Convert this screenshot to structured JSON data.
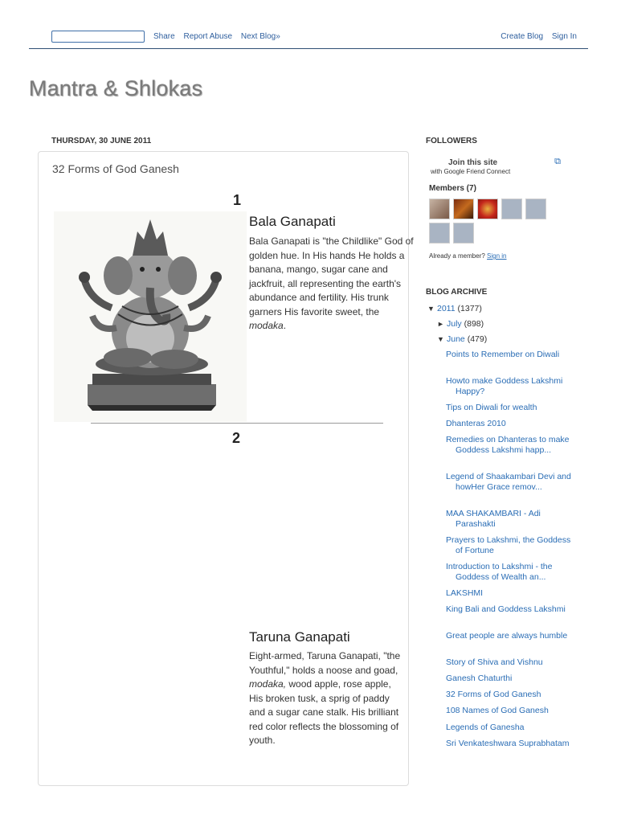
{
  "navbar": {
    "search_value": "",
    "share": "Share",
    "report_abuse": "Report Abuse",
    "next_blog": "Next Blog»",
    "create_blog": "Create Blog",
    "sign_in": "Sign In"
  },
  "blog_title": "Mantra & Shlokas",
  "post": {
    "date": "THURSDAY, 30 JUNE 2011",
    "title": "32 Forms of God Ganesh",
    "sections": [
      {
        "number": "1",
        "name": "Bala Ganapati",
        "text_before": "Bala Ganapati is \"the Childlike\" God of golden hue. In His hands He holds a banana, mango, sugar cane and jackfruit, all representing the earth's abundance and fertility. His trunk garners His favorite sweet, the ",
        "text_italic": "modaka",
        "text_after": "."
      },
      {
        "number": "2",
        "name": "Taruna Ganapati",
        "text_before": "Eight-armed, Taruna Ganapati, \"the Youthful,\" holds a noose and goad, ",
        "text_italic": "modaka,",
        "text_after": " wood apple, rose apple, His broken tusk, a sprig of paddy and a sugar cane stalk. His brilliant red color reflects the blossoming of youth."
      }
    ]
  },
  "followers": {
    "heading": "FOLLOWERS",
    "join": "Join this site",
    "with": "with Google Friend Connect",
    "members": "Members (7)",
    "already": "Already a member?",
    "sign_in": "Sign in",
    "expand_icon": "popout-icon"
  },
  "archive": {
    "heading": "BLOG ARCHIVE",
    "year": {
      "label": "2011",
      "count": "(1377)",
      "toggle": "▼"
    },
    "months": [
      {
        "label": "July",
        "count": "(898)",
        "toggle": "►"
      },
      {
        "label": "June",
        "count": "(479)",
        "toggle": "▼"
      }
    ],
    "posts": [
      "Points to Remember on Diwali",
      "Howto make Goddess Lakshmi Happy?",
      "Tips on Diwali for wealth",
      "Dhanteras 2010",
      "Remedies on Dhanteras to make Goddess Lakshmi happ...",
      "Legend of Shaakambari Devi and howHer Grace remov...",
      "MAA SHAKAMBARI - Adi Parashakti",
      "Prayers to Lakshmi, the Goddess of Fortune",
      "Introduction to Lakshmi - the Goddess of Wealth an...",
      "LAKSHMI",
      "King Bali and Goddess Lakshmi",
      "Great people are always humble",
      "Story of Shiva and Vishnu",
      "Ganesh Chaturthi",
      "32 Forms of God Ganesh",
      "108 Names of God Ganesh",
      "Legends of Ganesha",
      "Sri Venkateshwara Suprabhatam"
    ]
  }
}
